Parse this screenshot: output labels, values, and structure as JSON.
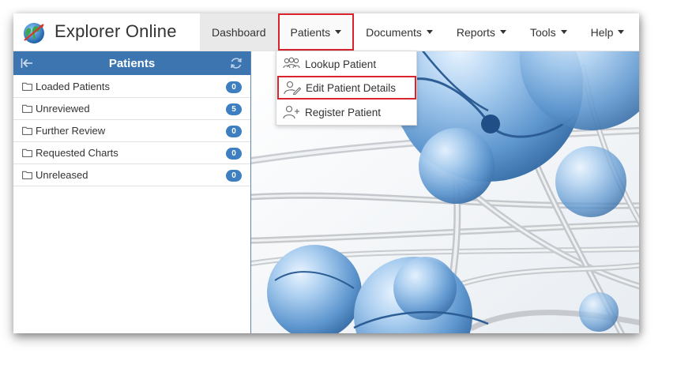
{
  "app": {
    "title": "Explorer Online"
  },
  "nav": {
    "items": [
      {
        "label": "Dashboard",
        "has_caret": false
      },
      {
        "label": "Patients",
        "has_caret": true
      },
      {
        "label": "Documents",
        "has_caret": true
      },
      {
        "label": "Reports",
        "has_caret": true
      },
      {
        "label": "Tools",
        "has_caret": true
      },
      {
        "label": "Help",
        "has_caret": true
      }
    ]
  },
  "patients_menu": {
    "items": [
      {
        "label": "Lookup Patient",
        "icon": "users-icon"
      },
      {
        "label": "Edit Patient Details",
        "icon": "user-edit-icon"
      },
      {
        "label": "Register Patient",
        "icon": "user-add-icon"
      }
    ]
  },
  "sidebar": {
    "title": "Patients",
    "items": [
      {
        "label": "Loaded Patients",
        "count": "0"
      },
      {
        "label": "Unreviewed",
        "count": "5"
      },
      {
        "label": "Further Review",
        "count": "0"
      },
      {
        "label": "Requested Charts",
        "count": "0"
      },
      {
        "label": "Unreleased",
        "count": "0"
      }
    ]
  },
  "colors": {
    "accent": "#3d75b0",
    "badge": "#3d7fc1",
    "highlight_border": "#d9242e"
  }
}
